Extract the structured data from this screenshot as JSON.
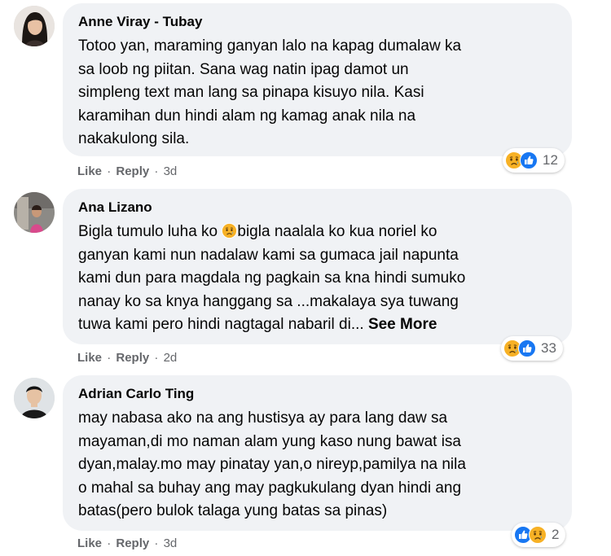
{
  "comments": [
    {
      "author": "Anne Viray - Tubay",
      "lines": [
        "Totoo yan, maraming ganyan lalo na kapag dumalaw ka",
        "sa loob ng piitan. Sana wag natin ipag damot un",
        "simpleng text man lang sa pinapa kisuyo nila. Kasi",
        "karamihan dun hindi alam ng kamag anak nila na",
        "nakakulong sila."
      ],
      "like_label": "Like",
      "reply_label": "Reply",
      "time": "3d",
      "reaction_count": "12",
      "reactions": [
        "sad-icon",
        "like-icon"
      ]
    },
    {
      "author": "Ana Lizano",
      "line1_before_emoji": "Bigla tumulo luha ko ",
      "line1_after_emoji": "bigla naalala ko kua noriel ko",
      "lines": [
        "ganyan kami nun nadalaw kami sa gumaca jail napunta",
        "kami dun para magdala ng pagkain sa kna hindi sumuko",
        "nanay ko sa knya hanggang sa ...makalaya sya tuwang"
      ],
      "last_line": "tuwa kami pero hindi nagtagal nabaril di...",
      "see_more_label": "See More",
      "like_label": "Like",
      "reply_label": "Reply",
      "time": "2d",
      "reaction_count": "33",
      "reactions": [
        "sad-icon",
        "like-icon"
      ]
    },
    {
      "author": "Adrian Carlo Ting",
      "lines": [
        "may nabasa ako na ang hustisya ay para lang daw sa",
        "mayaman,di mo naman alam yung kaso nung bawat isa",
        "dyan,malay.mo may pinatay yan,o nireyp,pamilya na nila",
        "o mahal sa buhay ang may pagkukulang dyan hindi ang",
        "batas(pero bulok talaga yung batas sa pinas)"
      ],
      "like_label": "Like",
      "reply_label": "Reply",
      "time": "3d",
      "reaction_count": "2",
      "reactions": [
        "like-icon",
        "sad-icon"
      ]
    }
  ],
  "separator": "·",
  "colors": {
    "bubble": "#f0f2f5",
    "meta": "#65676b",
    "like_blue": "#1877f2",
    "sad_yellow": "#f7b125"
  }
}
